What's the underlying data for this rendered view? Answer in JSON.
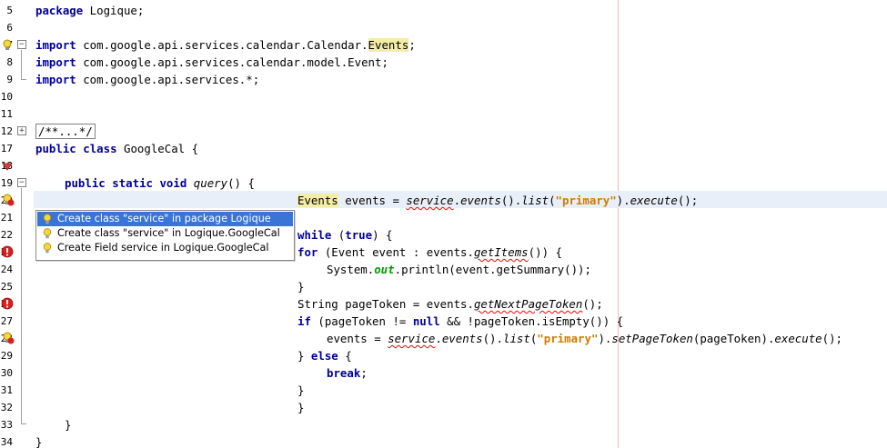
{
  "editor": {
    "line_numbers": [
      "5",
      "6",
      "7",
      "8",
      "9",
      "10",
      "11",
      "12",
      "17",
      "18",
      "19",
      "20",
      "21",
      "22",
      "23",
      "24",
      "25",
      "26",
      "27",
      "28",
      "29",
      "30",
      "31",
      "32",
      "33",
      "34"
    ],
    "code": {
      "package_kw": "package",
      "package_name": " Logique;",
      "import_kw": "import",
      "import1_path": " com.google.api.services.calendar.Calendar.",
      "import1_events": "Events",
      "import1_end": ";",
      "import2_path": " com.google.api.services.calendar.model.Event;",
      "import3_path": " com.google.api.services.*;",
      "collapsed_comment": "/**...*/",
      "public_kw": "public",
      "class_kw": "class",
      "class_name": " GoogleCal {",
      "static_kw": "static",
      "void_kw": "void",
      "method_name": "query",
      "method_end": "() {",
      "l20_type": "Events",
      "l20_assign": " events = ",
      "service": "service",
      "dot": ".",
      "events_call": "events",
      "paren_dot": "().",
      "list_call": "list",
      "open_paren": "(",
      "primary_str": "\"primary\"",
      "close_dot": ").",
      "execute_call": "execute",
      "stmt_end": "();",
      "while_kw": "while",
      "space_paren": " (",
      "true_kw": "true",
      "close_brace_open": ") {",
      "for_kw": "for",
      "for_body": " (Event event : events.",
      "getitems": "getItems",
      "for_end": "()) {",
      "system": "System.",
      "out": "out",
      "println_rest": ".println(event.getSummary());",
      "close_brace": "}",
      "l26_decl": "String pageToken = events.",
      "getnextpagetoken": "getNextPageToken",
      "l26_end": "();",
      "if_kw": "if",
      "if_cond1": " (pageToken != ",
      "null_kw": "null",
      "if_cond2": " && !pageToken.isEmpty()) {",
      "l28_assign": "events = ",
      "setpagetoken": "setPageToken",
      "pagetoken_arg": "(pageToken).",
      "else_open": "} ",
      "else_kw": "else",
      "else_brace": " {",
      "break_kw": "break",
      "semicolon": ";"
    }
  },
  "popup": {
    "items": [
      "Create class \"service\" in package Logique",
      "Create class \"service\" in Logique.GoogleCal",
      "Create Field service in Logique.GoogleCal"
    ],
    "selected_index": 0
  },
  "colors": {
    "keyword": "#000099",
    "string": "#ce7b00",
    "static_field": "#009900",
    "error_underline": "#ff0000",
    "selection": "#3875d7",
    "current_line": "#e9eff8",
    "occurrence_highlight": "#f3eda5"
  }
}
